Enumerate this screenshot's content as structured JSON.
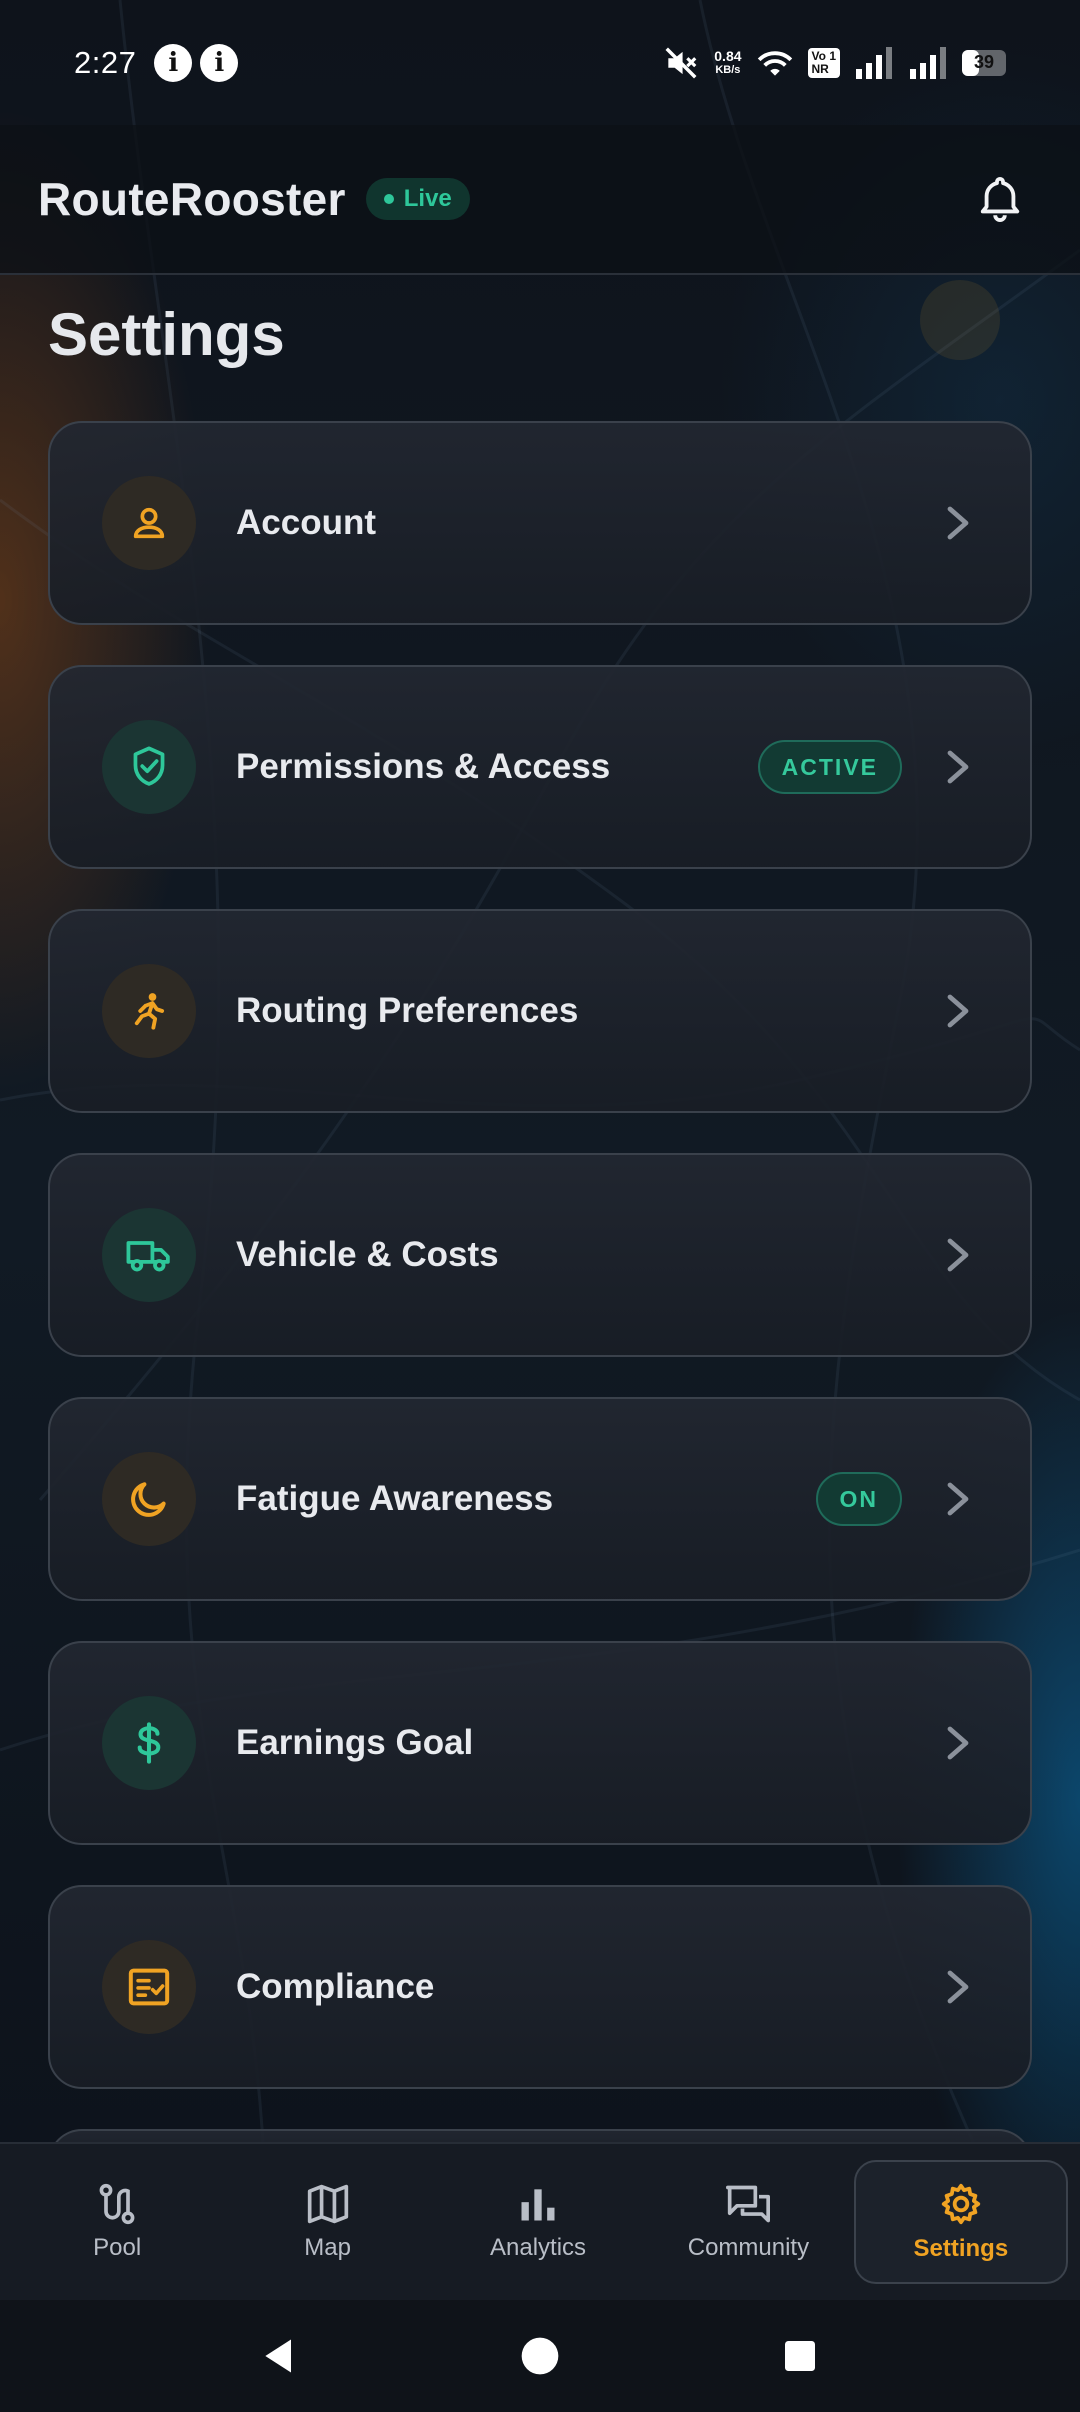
{
  "status_bar": {
    "time": "2:27",
    "net_speed_value": "0.84",
    "net_speed_unit": "KB/s",
    "volte_top": "Vo",
    "volte_bottom": "NR",
    "volte_sub": "1",
    "battery": "39"
  },
  "header": {
    "app_title": "RouteRooster",
    "live_label": "Live"
  },
  "page": {
    "title": "Settings"
  },
  "settings_items": [
    {
      "label": "Account",
      "icon": "person-icon",
      "badge": ""
    },
    {
      "label": "Permissions & Access",
      "icon": "shield-check-icon",
      "badge": "ACTIVE"
    },
    {
      "label": "Routing Preferences",
      "icon": "running-person-icon",
      "badge": ""
    },
    {
      "label": "Vehicle & Costs",
      "icon": "truck-icon",
      "badge": ""
    },
    {
      "label": "Fatigue Awareness",
      "icon": "moon-icon",
      "badge": "ON"
    },
    {
      "label": "Earnings Goal",
      "icon": "dollar-icon",
      "badge": ""
    },
    {
      "label": "Compliance",
      "icon": "checklist-icon",
      "badge": ""
    }
  ],
  "bottom_nav": {
    "items": [
      {
        "label": "Pool",
        "icon": "route-icon"
      },
      {
        "label": "Map",
        "icon": "map-icon"
      },
      {
        "label": "Analytics",
        "icon": "bar-chart-icon"
      },
      {
        "label": "Community",
        "icon": "chat-icon"
      },
      {
        "label": "Settings",
        "icon": "gear-icon"
      }
    ],
    "active": "Settings"
  },
  "colors": {
    "accent_orange": "#f0a323",
    "accent_green": "#2ec79a",
    "background": "#0d1118",
    "card": "#1e232c"
  }
}
